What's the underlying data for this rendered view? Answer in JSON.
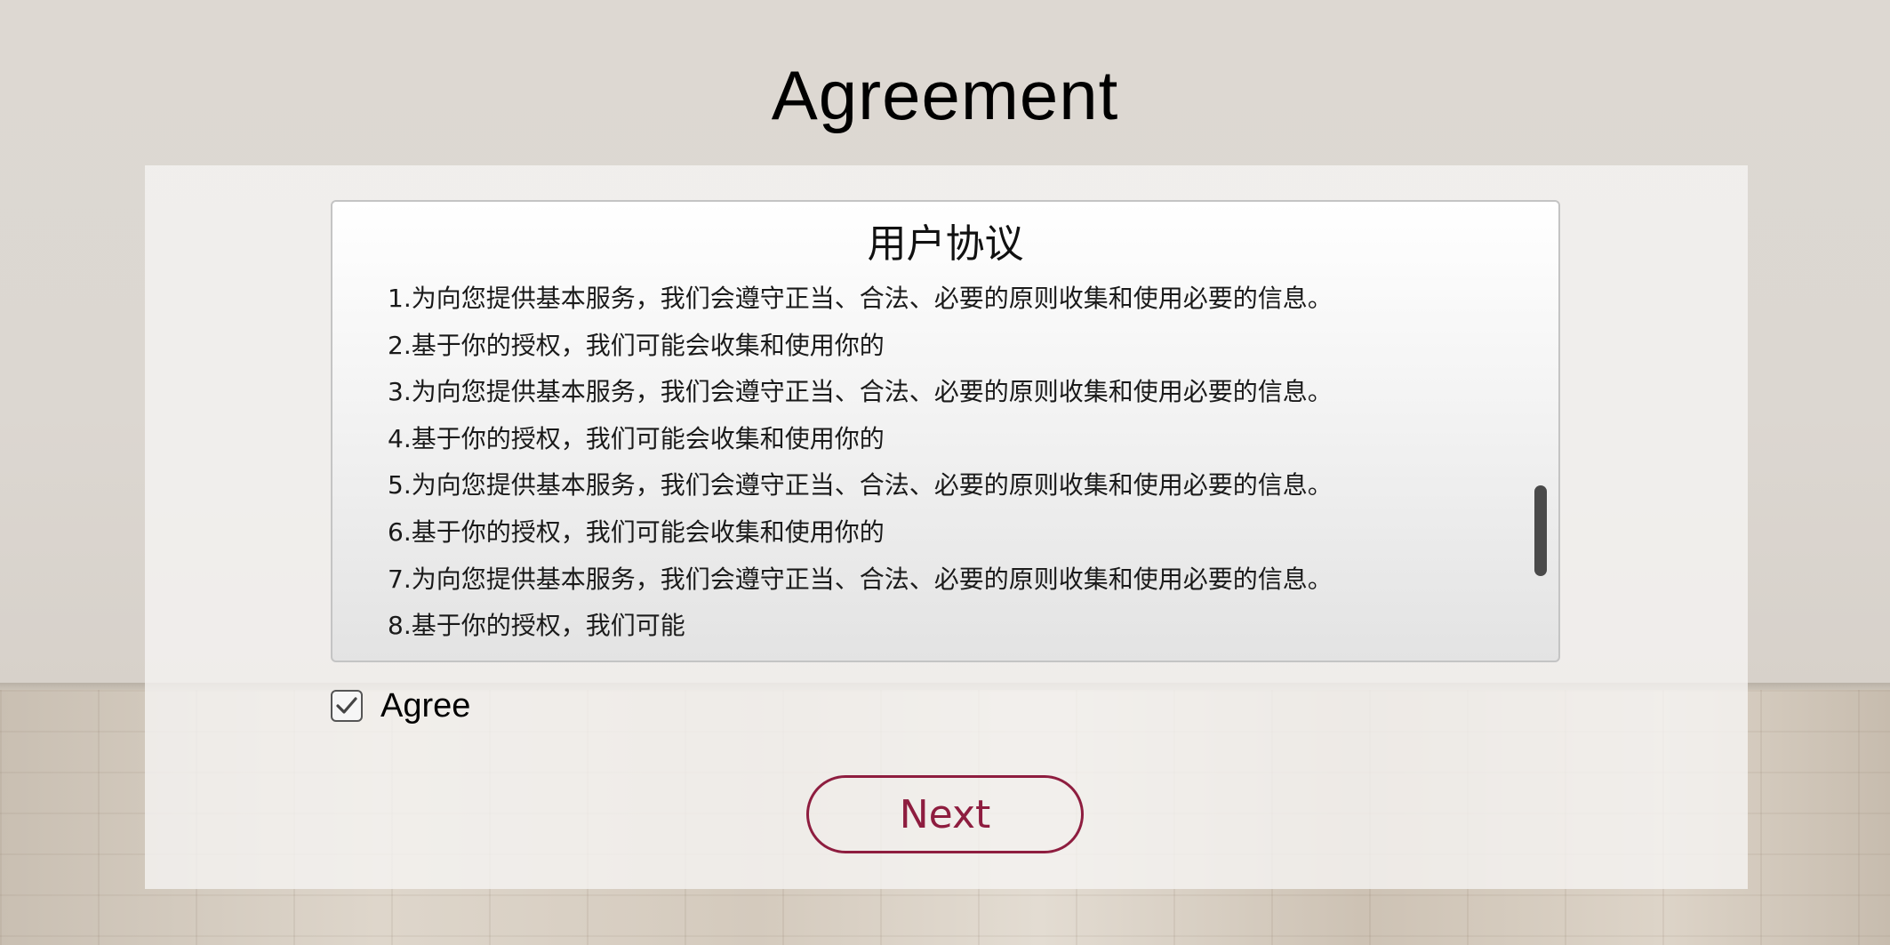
{
  "page": {
    "title": "Agreement"
  },
  "agreement": {
    "heading": "用户协议",
    "lines": [
      "1.为向您提供基本服务，我们会遵守正当、合法、必要的原则收集和使用必要的信息。",
      "2.基于你的授权，我们可能会收集和使用你的",
      "3.为向您提供基本服务，我们会遵守正当、合法、必要的原则收集和使用必要的信息。",
      "4.基于你的授权，我们可能会收集和使用你的",
      "5.为向您提供基本服务，我们会遵守正当、合法、必要的原则收集和使用必要的信息。",
      "6.基于你的授权，我们可能会收集和使用你的",
      "7.为向您提供基本服务，我们会遵守正当、合法、必要的原则收集和使用必要的信息。",
      "8.基于你的授权，我们可能"
    ]
  },
  "agree": {
    "label": "Agree",
    "checked": true,
    "icon": "check-icon"
  },
  "actions": {
    "next_label": "Next"
  },
  "colors": {
    "accent": "#8e1d3f",
    "scrollbar": "#4a4a4a",
    "wall": "#dcd7d1"
  }
}
